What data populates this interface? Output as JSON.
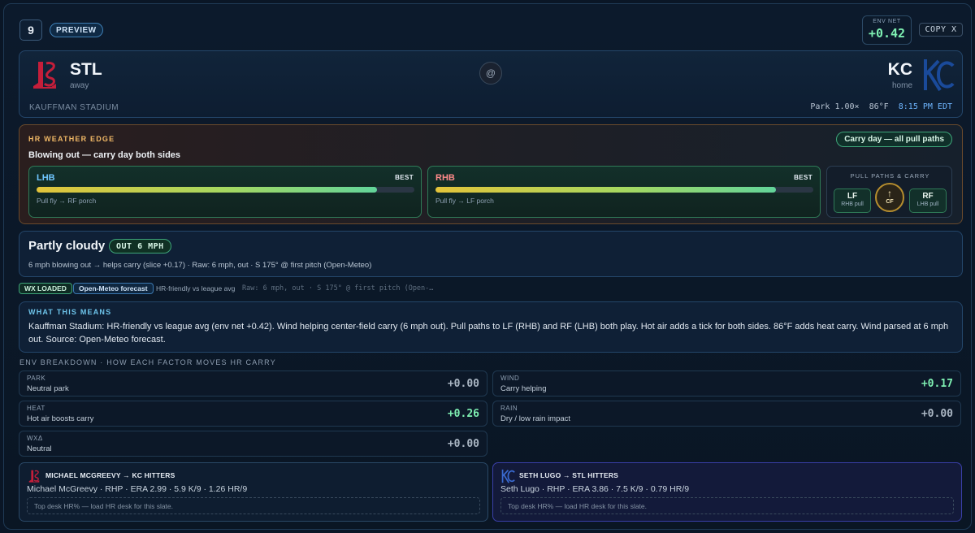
{
  "header": {
    "game_number": "9",
    "status_label": "PREVIEW",
    "env_net_label": "ENV NET",
    "env_net_value": "+0.42",
    "copy_label": "COPY X"
  },
  "matchup": {
    "away": {
      "abbr": "STL",
      "role": "away",
      "color": "#c41e3a"
    },
    "home": {
      "abbr": "KC",
      "role": "home",
      "color": "#1a4a9a"
    },
    "at_symbol": "@",
    "venue": "KAUFFMAN STADIUM",
    "park_factor": "Park 1.00×",
    "temperature": "86°F",
    "game_time": "8:15 PM EDT"
  },
  "weather_edge": {
    "title": "HR WEATHER EDGE",
    "summary": "Blowing out — carry day both sides",
    "badge": "Carry day — all pull paths",
    "lhb": {
      "label": "LHB",
      "tag": "BEST",
      "note": "Pull fly → RF porch",
      "fill": 0.9,
      "color": "#6fc6ff"
    },
    "rhb": {
      "label": "RHB",
      "tag": "BEST",
      "note": "Pull fly → LF porch",
      "fill": 0.9,
      "color": "#ff8a8a"
    },
    "pull_paths": {
      "title": "PULL PATHS & CARRY",
      "lf": {
        "label": "LF",
        "sub": "RHB pull"
      },
      "cf": {
        "arrow": "↑",
        "label": "CF"
      },
      "rf": {
        "label": "RF",
        "sub": "LHB pull"
      }
    }
  },
  "conditions": {
    "sky": "Partly cloudy",
    "wind_badge": "OUT 6 MPH",
    "description": "6 mph blowing out → helps carry (slice +0.17) · Raw: 6 mph, out · S 175° @ first pitch (Open-Meteo)"
  },
  "tags": {
    "wx_loaded": "WX LOADED",
    "source": "Open-Meteo forecast",
    "league_note": "HR-friendly vs league avg",
    "raw": "Raw: 6 mph, out · S 175° @ first pitch (Open-…"
  },
  "means": {
    "title": "WHAT THIS MEANS",
    "text": "Kauffman Stadium: HR-friendly vs league avg (env net +0.42). Wind helping center-field carry (6 mph out). Pull paths to LF (RHB) and RF (LHB) both play. Hot air adds a tick for both sides. 86°F adds heat carry. Wind parsed at 6 mph out. Source: Open-Meteo forecast."
  },
  "breakdown": {
    "title": "ENV BREAKDOWN · HOW EACH FACTOR MOVES HR CARRY",
    "park": {
      "key": "PARK",
      "desc": "Neutral park",
      "value": "+0.00"
    },
    "wind": {
      "key": "WIND",
      "desc": "Carry helping",
      "value": "+0.17"
    },
    "heat": {
      "key": "HEAT",
      "desc": "Hot air boosts carry",
      "value": "+0.26"
    },
    "rain": {
      "key": "RAIN",
      "desc": "Dry / low rain impact",
      "value": "+0.00"
    },
    "wx": {
      "key": "WXΔ",
      "desc": "Neutral",
      "value": "+0.00"
    }
  },
  "pitchers": {
    "away": {
      "header": "MICHAEL MCGREEVY → KC HITTERS",
      "line": "Michael McGreevy · RHP · ERA 2.99 · 5.9 K/9 · 1.26 HR/9",
      "note": "Top desk HR% — load HR desk for this slate."
    },
    "home": {
      "header": "SETH LUGO → STL HITTERS",
      "line": "Seth Lugo · RHP · ERA 3.86 · 7.5 K/9 · 0.79 HR/9",
      "note": "Top desk HR% — load HR desk for this slate."
    }
  }
}
